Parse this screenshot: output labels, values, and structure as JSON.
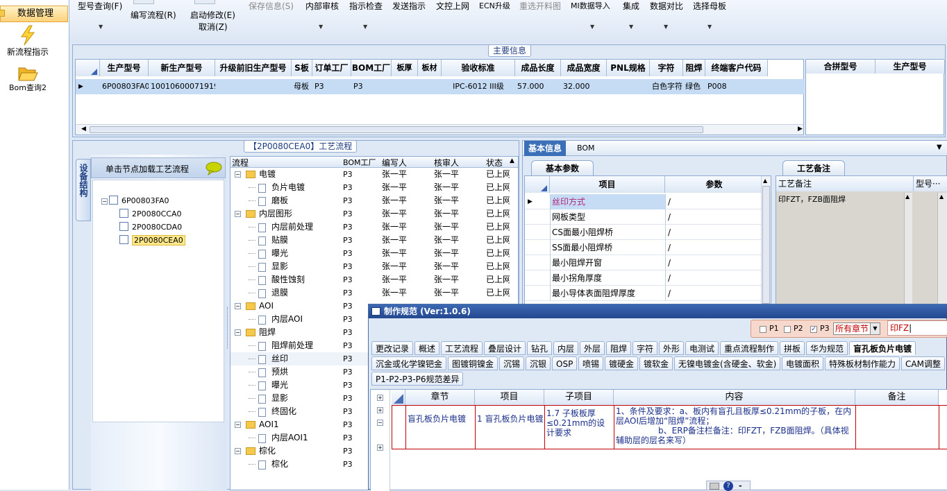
{
  "left_nav": {
    "data_mgmt": "数据管理",
    "new_flow": "新流程指示",
    "bom_query": "Bom查询2"
  },
  "toolbar": {
    "model_query": "型号查询(F)",
    "edit_flow": "编写流程(R)",
    "start_modify": "启动修改(E)",
    "cancel": "取消(Z)",
    "save_info": "保存信息(S)",
    "internal_review": "内部审核",
    "indicator_check": "指示检查",
    "send_indicator": "发送指示",
    "upload_doc": "文控上网",
    "ecn_upgrade": "ECN升级",
    "reselect_cutting": "重选开料图",
    "mi_import": "MI数据导入",
    "integrate": "集成",
    "data_compare": "数据对比",
    "select_master": "选择母板"
  },
  "main_info": {
    "title": "主要信息",
    "columns": [
      "生产型号",
      "新生产型号",
      "升级前旧生产型号",
      "S板",
      "订单工厂",
      "BOM工厂",
      "板厚",
      "板材",
      "验收标准",
      "成品长度",
      "成品宽度",
      "PNL规格",
      "字符",
      "阻焊",
      "终端客户代码"
    ],
    "row": [
      "6P00803FA0",
      "10010600071919",
      "",
      "母板",
      "P3",
      "P3",
      "",
      "",
      "IPC-6012 III级",
      "57.000",
      "32.000",
      "",
      "白色字符",
      "绿色",
      "P008"
    ],
    "merge_columns": [
      "合拼型号",
      "生产型号"
    ]
  },
  "process": {
    "title": "【2P0080CEA0】工艺流程",
    "side_tab": "设备结构",
    "hint": "单击节点加载工艺流程",
    "tree": {
      "root": "6P00803FA0",
      "children": [
        "2P0080CCA0",
        "2P0080CDA0",
        "2P0080CEA0"
      ]
    },
    "flow_headers": [
      "流程",
      "BOM工厂",
      "编写人",
      "核审人",
      "状态"
    ],
    "flow_rows": [
      {
        "name": "电镀",
        "type": "folder",
        "level": 1,
        "factory": "P3",
        "writer": "张一平",
        "checker": "张一平",
        "status": "已上网"
      },
      {
        "name": "负片电镀",
        "type": "doc",
        "level": 2,
        "factory": "P3",
        "writer": "张一平",
        "checker": "张一平",
        "status": "已上网"
      },
      {
        "name": "磨板",
        "type": "doc",
        "level": 2,
        "factory": "P3",
        "writer": "张一平",
        "checker": "张一平",
        "status": "已上网"
      },
      {
        "name": "内层图形",
        "type": "folder",
        "level": 1,
        "factory": "P3",
        "writer": "张一平",
        "checker": "张一平",
        "status": "已上网"
      },
      {
        "name": "内层前处理",
        "type": "doc",
        "level": 2,
        "factory": "P3",
        "writer": "张一平",
        "checker": "张一平",
        "status": "已上网"
      },
      {
        "name": "贴膜",
        "type": "doc",
        "level": 2,
        "factory": "P3",
        "writer": "张一平",
        "checker": "张一平",
        "status": "已上网"
      },
      {
        "name": "曝光",
        "type": "doc",
        "level": 2,
        "factory": "P3",
        "writer": "张一平",
        "checker": "张一平",
        "status": "已上网"
      },
      {
        "name": "显影",
        "type": "doc",
        "level": 2,
        "factory": "P3",
        "writer": "张一平",
        "checker": "张一平",
        "status": "已上网"
      },
      {
        "name": "酸性蚀刻",
        "type": "doc",
        "level": 2,
        "factory": "P3",
        "writer": "张一平",
        "checker": "张一平",
        "status": "已上网"
      },
      {
        "name": "退膜",
        "type": "doc",
        "level": 2,
        "factory": "P3",
        "writer": "张一平",
        "checker": "张一平",
        "status": "已上网"
      },
      {
        "name": "AOI",
        "type": "folder",
        "level": 1,
        "factory": "P3",
        "writer": "",
        "checker": "",
        "status": ""
      },
      {
        "name": "内层AOI",
        "type": "doc",
        "level": 2,
        "factory": "P3",
        "writer": "",
        "checker": "",
        "status": ""
      },
      {
        "name": "阻焊",
        "type": "folder",
        "level": 1,
        "factory": "P3",
        "writer": "",
        "checker": "",
        "status": ""
      },
      {
        "name": "阻焊前处理",
        "type": "doc",
        "level": 2,
        "factory": "P3",
        "writer": "",
        "checker": "",
        "status": ""
      },
      {
        "name": "丝印",
        "type": "doc",
        "level": 2,
        "factory": "P3",
        "writer": "",
        "checker": "",
        "status": ""
      },
      {
        "name": "预烘",
        "type": "doc",
        "level": 2,
        "factory": "P3",
        "writer": "",
        "checker": "",
        "status": ""
      },
      {
        "name": "曝光",
        "type": "doc",
        "level": 2,
        "factory": "P3",
        "writer": "",
        "checker": "",
        "status": ""
      },
      {
        "name": "显影",
        "type": "doc",
        "level": 2,
        "factory": "P3",
        "writer": "",
        "checker": "",
        "status": ""
      },
      {
        "name": "终固化",
        "type": "doc",
        "level": 2,
        "factory": "P3",
        "writer": "",
        "checker": "",
        "status": ""
      },
      {
        "name": "AOI1",
        "type": "folder",
        "level": 1,
        "factory": "P3",
        "writer": "",
        "checker": "",
        "status": ""
      },
      {
        "name": "内层AOI1",
        "type": "doc",
        "level": 2,
        "factory": "P3",
        "writer": "",
        "checker": "",
        "status": ""
      },
      {
        "name": "棕化",
        "type": "folder",
        "level": 1,
        "factory": "P3",
        "writer": "",
        "checker": "",
        "status": ""
      },
      {
        "name": "棕化",
        "type": "doc",
        "level": 2,
        "factory": "P3",
        "writer": "",
        "checker": "",
        "status": ""
      }
    ]
  },
  "basic_info": {
    "tab_basic": "基本信息",
    "tab_bom": "BOM",
    "params_title": "基本参数",
    "col_item": "项目",
    "col_param": "参数",
    "params": [
      {
        "item": "丝印方式",
        "value": "/"
      },
      {
        "item": "网板类型",
        "value": "/"
      },
      {
        "item": "CS面最小阻焊桥",
        "value": "/"
      },
      {
        "item": "SS面最小阻焊桥",
        "value": "/"
      },
      {
        "item": "最小阻焊开窗",
        "value": "/"
      },
      {
        "item": "最小拐角厚度",
        "value": "/"
      },
      {
        "item": "最小导体表面阻焊厚度",
        "value": "/"
      }
    ],
    "remarks_title": "工艺备注",
    "remarks_col": "工艺备注",
    "remarks_col2": "型号···",
    "remarks_text": "印FZT，FZB面阻焊"
  },
  "spec_window": {
    "title": "制作规范 (Ver:1.0.6)",
    "p1": "P1",
    "p2": "P2",
    "p3": "P3",
    "chapter_select": "所有章节",
    "search_value": "印FZ",
    "tabs_row1": [
      "更改记录",
      "概述",
      "工艺流程",
      "叠层设计",
      "钻孔",
      "内层",
      "外层",
      "阻焊",
      "字符",
      "外形",
      "电测试",
      "重点流程制作",
      "拼板",
      "华为规范",
      "盲孔板负片电镀"
    ],
    "tabs_row2": [
      "沉金或化学镍钯金",
      "图镀铜镍金",
      "沉锡",
      "沉银",
      "OSP",
      "喷锡",
      "镀硬金",
      "镀软金",
      "无镍电镀金(含硬金、软金)",
      "电镀面积",
      "特殊板材制作能力",
      "CAM调整"
    ],
    "tabs_row3": [
      "P1-P2-P3-P6规范差异"
    ],
    "grid_headers": [
      "章节",
      "项目",
      "子项目",
      "内容",
      "备注"
    ],
    "grid_row": {
      "chapter": "盲孔板负片电镀",
      "item": "1 盲孔板负片电镀",
      "subitem": "1.7 子板板厚≤0.21mm的设计要求",
      "content": "1、条件及要求：a、板内有盲孔且板厚≤0.21mm的子板，在内层AOI后增加“阻焊”流程；\n                b、ERP备注栏备注：印FZT，FZB面阻焊。（具体视辅助层的层名来写）",
      "remark": ""
    }
  }
}
